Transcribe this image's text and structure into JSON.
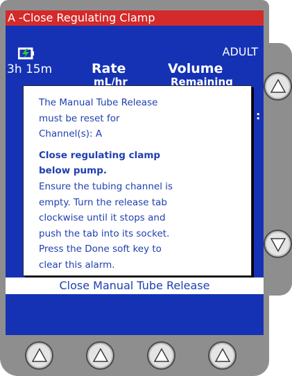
{
  "alarm": {
    "title": "A -Close Regulating Clamp"
  },
  "status": {
    "battery_icon": "battery-charging-icon",
    "time_remaining": "3h 15m",
    "patient_type": "ADULT"
  },
  "columns": {
    "rate_label": "Rate",
    "rate_unit": "mL/hr",
    "volume_label": "Volume",
    "volume_sub": "Remaining"
  },
  "dialog": {
    "lines": [
      "The Manual Tube Release",
      "must be reset for",
      "Channel(s): A"
    ],
    "bold_lines": [
      "Close regulating clamp",
      "below pump."
    ],
    "instructions": [
      "Ensure the tubing channel is",
      "empty.  Turn the release tab",
      "clockwise until it stops and",
      "push the tab into its socket.",
      "Press the Done soft key to",
      "clear this alarm."
    ]
  },
  "softkey_bar": {
    "label": "Close Manual Tube Release"
  },
  "keys": {
    "scroll_up_icon": "up-arrow-icon",
    "scroll_down_icon": "down-arrow-icon",
    "softkey_icon": "up-arrow-icon"
  },
  "colors": {
    "screen": "#1532b4",
    "alarm": "#d42a2a",
    "bezel": "#8e8e8e",
    "battery": "#2ecc2e"
  }
}
